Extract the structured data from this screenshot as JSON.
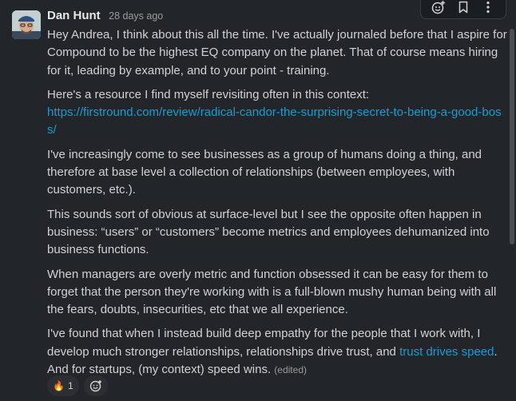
{
  "message": {
    "author": "Dan Hunt",
    "timestamp": "28 days ago",
    "paragraphs": {
      "p1": "Hey Andrea, I think about this all the time. I've actually journaled before that I aspire for Compound to be the highest EQ company on the planet. That of course means hiring for it, leading by example, and to your point - training.",
      "p2": "Here's a resource I find myself revisiting often in this context:",
      "link": "https://firstround.com/review/radical-candor-the-surprising-secret-to-being-a-good-boss/",
      "p3": "I've increasingly come to see businesses as a group of humans doing a thing, and therefore at base level a collection of relationships (between employees, with customers, etc.).",
      "p4": "This sounds sort of obvious at surface-level but I see the opposite often happen in business: “users” or “customers” become metrics and employees dehumanized into business functions.",
      "p5": "When managers are overly metric and function obsessed it can be easy for them to forget that the person they're working with is a full-blown mushy human being with all the fears, doubts, insecurities, etc that we all experience.",
      "p6_before": "I've found that when I instead build deep empathy for the people that I work with, I develop much stronger relationships, relationships drive trust, and ",
      "p6_link": "trust drives speed",
      "p6_after": ". And for startups, (my context) speed wins. ",
      "edited": "(edited)"
    },
    "reactions": [
      {
        "emoji": "🔥",
        "count": "1"
      }
    ]
  },
  "toolbar": {
    "icons": [
      "add-reaction-icon",
      "bookmark-icon",
      "more-icon"
    ]
  },
  "colors": {
    "background": "#222529",
    "link": "#1d9bd1",
    "text": "#d1d2d3",
    "muted": "#9a9b9d"
  }
}
